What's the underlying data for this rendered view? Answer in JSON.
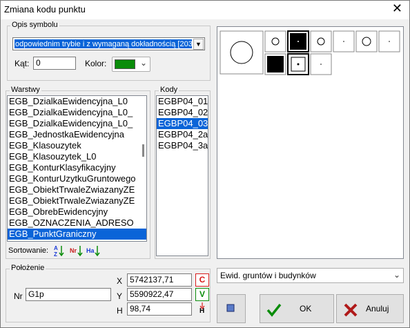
{
  "window": {
    "title": "Zmiana kodu punktu",
    "close_glyph": "✕"
  },
  "opis": {
    "legend": "Opis symbolu",
    "dropdown_value": "odpowiednim trybie i z wymaganą dokładnością [203]",
    "kat_label": "Kąt:",
    "kat_value": "0",
    "kolor_label": "Kolor:",
    "kolor_value": "#0a8c0a"
  },
  "warstwy": {
    "legend": "Warstwy",
    "items": [
      "EGB_DzialkaEwidencyjna_L0",
      "EGB_DzialkaEwidencyjna_L0_",
      "EGB_DzialkaEwidencyjna_L0_",
      "EGB_JednostkaEwidencyjna",
      "EGB_Klasouzytek",
      "EGB_Klasouzytek_L0",
      "EGB_KonturKlasyfikacyjny",
      "EGB_KonturUzytkuGruntowego",
      "EGB_ObiektTrwaleZwiazanyZE",
      "EGB_ObiektTrwaleZwiazanyZE",
      "EGB_ObrebEwidencyjny",
      "EGB_OZNACZENIA_ADRESO",
      "EGB_PunktGraniczny"
    ],
    "selected_index": 12,
    "sort_label": "Sortowanie:",
    "sort_buttons": [
      "AZ",
      "Nr",
      "Ha"
    ]
  },
  "kody": {
    "legend": "Kody",
    "items": [
      "EGBP04_01",
      "EGBP04_02",
      "EGBP04_03",
      "EGBP04_2a",
      "EGBP04_3a"
    ],
    "selected_index": 2
  },
  "polozenie": {
    "legend": "Położenie",
    "nr_label": "Nr",
    "nr_value": "G1p",
    "x_label": "X",
    "x_value": "5742137,71",
    "y_label": "Y",
    "y_value": "5590922,47",
    "h_label": "H",
    "h_value": "98,74",
    "c_button": "C",
    "v_button": "V",
    "h_button": "H"
  },
  "preview_combo": "Ewid. gruntów i budynków",
  "buttons": {
    "ok": "OK",
    "cancel": "Anuluj"
  }
}
